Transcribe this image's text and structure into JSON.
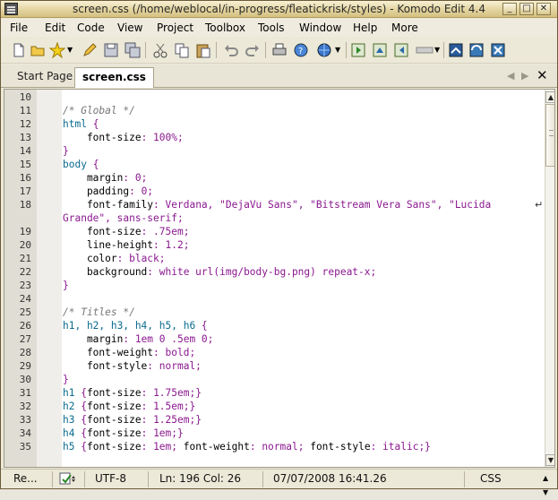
{
  "window": {
    "title": "screen.css (/home/weblocal/in-progress/fleatickrisk/styles) - Komodo Edit 4.4",
    "minimize_glyph": "_",
    "maximize_glyph": "□",
    "close_glyph": "✕"
  },
  "menu": [
    "File",
    "Edit",
    "Code",
    "View",
    "Project",
    "Toolbox",
    "Tools",
    "Window",
    "Help",
    "More"
  ],
  "toolbar": {
    "icons": [
      "new-file-icon",
      "open-folder-icon",
      "favorites-star-icon",
      "pencil-icon",
      "save-icon",
      "save-all-icon",
      "cut-icon",
      "copy-icon",
      "paste-icon",
      "undo-icon",
      "redo-icon",
      "print-icon",
      "help-icon",
      "browser-icon",
      "run-icon",
      "macro-icon",
      "back-icon",
      "forward-icon",
      "source-control-icon",
      "komodo-icon",
      "toolbox-icon"
    ]
  },
  "tabs": {
    "items": [
      {
        "label": "Start Page",
        "active": false
      },
      {
        "label": "screen.css",
        "active": true
      }
    ],
    "prev_glyph": "◀",
    "next_glyph": "▶",
    "close_glyph": "✕"
  },
  "editor": {
    "lines": [
      {
        "n": "10",
        "parts": []
      },
      {
        "n": "11",
        "parts": [
          {
            "t": "/* Global */",
            "c": "c-comment"
          }
        ]
      },
      {
        "n": "12",
        "parts": [
          {
            "t": "html ",
            "c": "c-sel"
          },
          {
            "t": "{",
            "c": "c-punc"
          }
        ]
      },
      {
        "n": "13",
        "parts": [
          {
            "t": "    font-size",
            "c": ""
          },
          {
            "t": ": 100%;",
            "c": "c-val"
          }
        ]
      },
      {
        "n": "14",
        "parts": [
          {
            "t": "}",
            "c": "c-punc"
          }
        ]
      },
      {
        "n": "15",
        "parts": [
          {
            "t": "body ",
            "c": "c-sel"
          },
          {
            "t": "{",
            "c": "c-punc"
          }
        ]
      },
      {
        "n": "16",
        "parts": [
          {
            "t": "    margin",
            "c": ""
          },
          {
            "t": ": 0;",
            "c": "c-val"
          }
        ]
      },
      {
        "n": "17",
        "parts": [
          {
            "t": "    padding",
            "c": ""
          },
          {
            "t": ": 0;",
            "c": "c-val"
          }
        ]
      },
      {
        "n": "18",
        "parts": [
          {
            "t": "    font-family",
            "c": ""
          },
          {
            "t": ": Verdana, \"DejaVu Sans\", \"Bitstream Vera Sans\", \"Lucida",
            "c": "c-str"
          }
        ],
        "wrap": true
      },
      {
        "n": "",
        "parts": [
          {
            "t": "Grande\", sans-serif;",
            "c": "c-str"
          }
        ]
      },
      {
        "n": "19",
        "parts": [
          {
            "t": "    font-size",
            "c": ""
          },
          {
            "t": ": .75em;",
            "c": "c-val"
          }
        ]
      },
      {
        "n": "20",
        "parts": [
          {
            "t": "    line-height",
            "c": ""
          },
          {
            "t": ": 1.2;",
            "c": "c-val"
          }
        ]
      },
      {
        "n": "21",
        "parts": [
          {
            "t": "    color",
            "c": ""
          },
          {
            "t": ": black;",
            "c": "c-val"
          }
        ]
      },
      {
        "n": "22",
        "parts": [
          {
            "t": "    background",
            "c": ""
          },
          {
            "t": ": white url(img/body-bg.png) repeat-x;",
            "c": "c-val"
          }
        ]
      },
      {
        "n": "23",
        "parts": [
          {
            "t": "}",
            "c": "c-punc"
          }
        ]
      },
      {
        "n": "24",
        "parts": []
      },
      {
        "n": "25",
        "parts": [
          {
            "t": "/* Titles */",
            "c": "c-comment"
          }
        ]
      },
      {
        "n": "26",
        "parts": [
          {
            "t": "h1, h2, h3, h4, h5, h6 ",
            "c": "c-sel"
          },
          {
            "t": "{",
            "c": "c-punc"
          }
        ]
      },
      {
        "n": "27",
        "parts": [
          {
            "t": "    margin",
            "c": ""
          },
          {
            "t": ": 1em 0 .5em 0;",
            "c": "c-val"
          }
        ]
      },
      {
        "n": "28",
        "parts": [
          {
            "t": "    font-weight",
            "c": ""
          },
          {
            "t": ": bold;",
            "c": "c-val"
          }
        ]
      },
      {
        "n": "29",
        "parts": [
          {
            "t": "    font-style",
            "c": ""
          },
          {
            "t": ": normal;",
            "c": "c-val"
          }
        ]
      },
      {
        "n": "30",
        "parts": [
          {
            "t": "}",
            "c": "c-punc"
          }
        ]
      },
      {
        "n": "31",
        "parts": [
          {
            "t": "h1 ",
            "c": "c-sel"
          },
          {
            "t": "{",
            "c": "c-punc"
          },
          {
            "t": "font-size",
            "c": ""
          },
          {
            "t": ": 1.75em;}",
            "c": "c-val"
          }
        ]
      },
      {
        "n": "32",
        "parts": [
          {
            "t": "h2 ",
            "c": "c-sel"
          },
          {
            "t": "{",
            "c": "c-punc"
          },
          {
            "t": "font-size",
            "c": ""
          },
          {
            "t": ": 1.5em;}",
            "c": "c-val"
          }
        ]
      },
      {
        "n": "33",
        "parts": [
          {
            "t": "h3 ",
            "c": "c-sel"
          },
          {
            "t": "{",
            "c": "c-punc"
          },
          {
            "t": "font-size",
            "c": ""
          },
          {
            "t": ": 1.25em;}",
            "c": "c-val"
          }
        ]
      },
      {
        "n": "34",
        "parts": [
          {
            "t": "h4 ",
            "c": "c-sel"
          },
          {
            "t": "{",
            "c": "c-punc"
          },
          {
            "t": "font-size",
            "c": ""
          },
          {
            "t": ": 1em;}",
            "c": "c-val"
          }
        ]
      },
      {
        "n": "35",
        "parts": [
          {
            "t": "h5 ",
            "c": "c-sel"
          },
          {
            "t": "{",
            "c": "c-punc"
          },
          {
            "t": "font-size",
            "c": ""
          },
          {
            "t": ": 1em; ",
            "c": "c-val"
          },
          {
            "t": "font-weight",
            "c": ""
          },
          {
            "t": ": normal; ",
            "c": "c-val"
          },
          {
            "t": "font-style",
            "c": ""
          },
          {
            "t": ": italic;}",
            "c": "c-val"
          }
        ]
      }
    ],
    "wrap_glyph": "↵",
    "scroll_up_glyph": "▲",
    "scroll_down_glyph": "▼"
  },
  "statusbar": {
    "notifications": "Re...",
    "check_icon": "syntax-check-icon",
    "encoding": "UTF-8",
    "position": "Ln: 196 Col: 26",
    "timestamp": "07/07/2008 16:41.26",
    "language": "CSS"
  },
  "colors": {
    "selector": "#0a6b8e",
    "value": "#8a188f",
    "comment": "#777777"
  }
}
